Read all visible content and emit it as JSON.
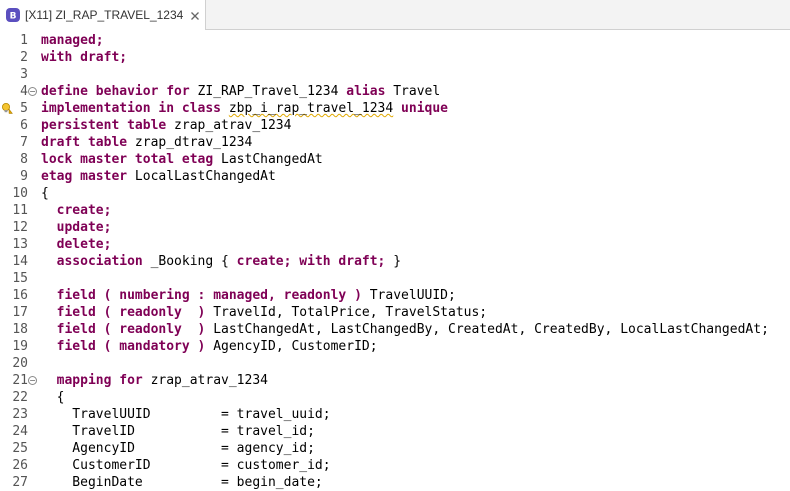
{
  "tab": {
    "title": "[X11] ZI_RAP_TRAVEL_1234",
    "icon": "abap-behavior-definition-icon"
  },
  "colors": {
    "keyword": "#7f0055",
    "tab_icon": "#5b4fbf",
    "warning": "#e0a800"
  },
  "editor": {
    "lines": [
      {
        "num": "1",
        "segs": [
          {
            "t": "managed;",
            "k": 1
          }
        ]
      },
      {
        "num": "2",
        "segs": [
          {
            "t": "with draft;",
            "k": 1
          }
        ]
      },
      {
        "num": "3",
        "segs": []
      },
      {
        "num": "4",
        "fold": true,
        "segs": [
          {
            "t": "define behavior for",
            "k": 1
          },
          {
            "t": " ZI_RAP_Travel_1234 "
          },
          {
            "t": "alias",
            "k": 1
          },
          {
            "t": " Travel"
          }
        ]
      },
      {
        "num": "5",
        "warn": true,
        "segs": [
          {
            "t": "implementation in class",
            "k": 1
          },
          {
            "t": " "
          },
          {
            "t": "zbp_i_rap_travel_1234",
            "sq": 1
          },
          {
            "t": " "
          },
          {
            "t": "unique",
            "k": 1
          }
        ]
      },
      {
        "num": "6",
        "segs": [
          {
            "t": "persistent table",
            "k": 1
          },
          {
            "t": " zrap_atrav_1234"
          }
        ]
      },
      {
        "num": "7",
        "segs": [
          {
            "t": "draft table",
            "k": 1
          },
          {
            "t": " zrap_dtrav_1234"
          }
        ]
      },
      {
        "num": "8",
        "segs": [
          {
            "t": "lock master total etag",
            "k": 1
          },
          {
            "t": " LastChangedAt"
          }
        ]
      },
      {
        "num": "9",
        "segs": [
          {
            "t": "etag master",
            "k": 1
          },
          {
            "t": " LocalLastChangedAt"
          }
        ]
      },
      {
        "num": "10",
        "segs": [
          {
            "t": "{"
          }
        ]
      },
      {
        "num": "11",
        "segs": [
          {
            "t": "  "
          },
          {
            "t": "create;",
            "k": 1
          }
        ]
      },
      {
        "num": "12",
        "segs": [
          {
            "t": "  "
          },
          {
            "t": "update;",
            "k": 1
          }
        ]
      },
      {
        "num": "13",
        "segs": [
          {
            "t": "  "
          },
          {
            "t": "delete;",
            "k": 1
          }
        ]
      },
      {
        "num": "14",
        "segs": [
          {
            "t": "  "
          },
          {
            "t": "association",
            "k": 1
          },
          {
            "t": " _Booking { "
          },
          {
            "t": "create; with draft;",
            "k": 1
          },
          {
            "t": " }"
          }
        ]
      },
      {
        "num": "15",
        "segs": []
      },
      {
        "num": "16",
        "segs": [
          {
            "t": "  "
          },
          {
            "t": "field ( numbering : managed, readonly )",
            "k": 1
          },
          {
            "t": " TravelUUID;"
          }
        ]
      },
      {
        "num": "17",
        "segs": [
          {
            "t": "  "
          },
          {
            "t": "field ( readonly  )",
            "k": 1
          },
          {
            "t": " TravelId, TotalPrice, TravelStatus;"
          }
        ]
      },
      {
        "num": "18",
        "segs": [
          {
            "t": "  "
          },
          {
            "t": "field ( readonly  )",
            "k": 1
          },
          {
            "t": " LastChangedAt, LastChangedBy, CreatedAt, CreatedBy, LocalLastChangedAt;"
          }
        ]
      },
      {
        "num": "19",
        "segs": [
          {
            "t": "  "
          },
          {
            "t": "field ( mandatory )",
            "k": 1
          },
          {
            "t": " AgencyID, CustomerID;"
          }
        ]
      },
      {
        "num": "20",
        "segs": []
      },
      {
        "num": "21",
        "fold": true,
        "segs": [
          {
            "t": "  "
          },
          {
            "t": "mapping for",
            "k": 1
          },
          {
            "t": " zrap_atrav_1234"
          }
        ]
      },
      {
        "num": "22",
        "segs": [
          {
            "t": "  {"
          }
        ]
      },
      {
        "num": "23",
        "segs": [
          {
            "t": "    TravelUUID         = travel_uuid;"
          }
        ]
      },
      {
        "num": "24",
        "segs": [
          {
            "t": "    TravelID           = travel_id;"
          }
        ]
      },
      {
        "num": "25",
        "segs": [
          {
            "t": "    AgencyID           = agency_id;"
          }
        ]
      },
      {
        "num": "26",
        "segs": [
          {
            "t": "    CustomerID         = customer_id;"
          }
        ]
      },
      {
        "num": "27",
        "segs": [
          {
            "t": "    BeginDate          = begin_date;"
          }
        ]
      }
    ]
  }
}
